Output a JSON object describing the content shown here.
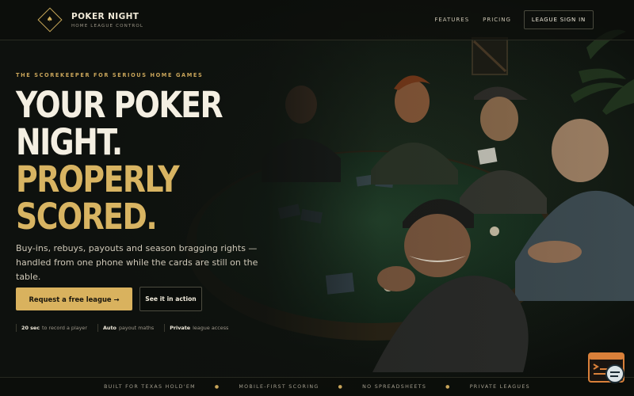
{
  "brand": {
    "name": "POKER NIGHT",
    "tagline": "HOME LEAGUE CONTROL",
    "logo_icon": "spade-diamond-icon"
  },
  "nav": {
    "features": "FEATURES",
    "pricing": "PRICING",
    "signin": "LEAGUE SIGN IN"
  },
  "hero": {
    "eyebrow": "THE SCOREKEEPER FOR SERIOUS HOME GAMES",
    "headline_1": "YOUR POKER",
    "headline_2": "NIGHT.",
    "headline_3": "PROPERLY",
    "headline_4": "SCORED.",
    "subcopy": "Buy-ins, rebuys, payouts and season bragging rights — handled from one phone while the cards are still on the table.",
    "cta_primary": "Request a free league →",
    "cta_secondary": "See it in action"
  },
  "stats": [
    {
      "value": "20 sec",
      "label": "to record a player"
    },
    {
      "value": "Auto",
      "label": "payout maths"
    },
    {
      "value": "Private",
      "label": "league access"
    }
  ],
  "ticker": [
    "BUILT FOR TEXAS HOLD'EM",
    "MOBILE-FIRST SCORING",
    "NO SPREADSHEETS",
    "PRIVATE LEAGUES"
  ],
  "colors": {
    "accent": "#d8b462",
    "background": "#0f1310",
    "felt": "#1d3a26"
  }
}
